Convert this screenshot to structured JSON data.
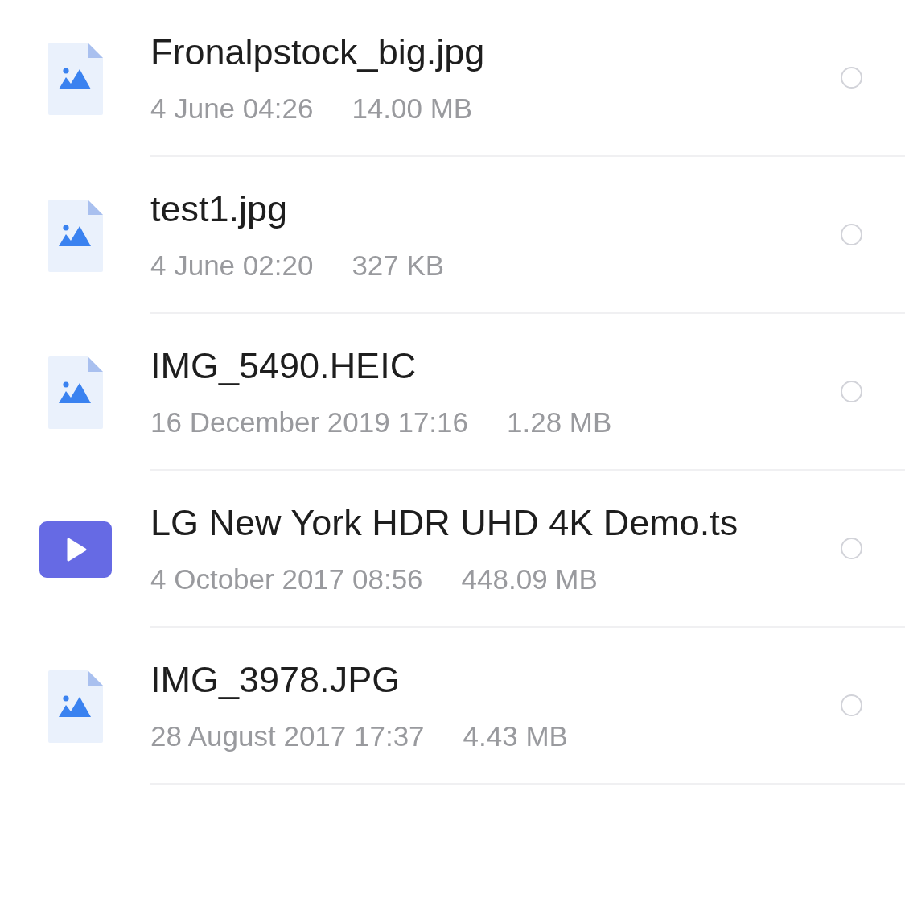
{
  "files": [
    {
      "kind": "image",
      "name": "Fronalpstock_big.jpg",
      "date": "4 June 04:26",
      "size": "14.00 MB",
      "selected": false
    },
    {
      "kind": "image",
      "name": "test1.jpg",
      "date": "4 June 02:20",
      "size": "327 KB",
      "selected": false
    },
    {
      "kind": "image",
      "name": "IMG_5490.HEIC",
      "date": "16 December 2019 17:16",
      "size": "1.28 MB",
      "selected": false
    },
    {
      "kind": "video",
      "name": "LG New York HDR UHD 4K Demo.ts",
      "date": "4 October 2017 08:56",
      "size": "448.09 MB",
      "selected": false
    },
    {
      "kind": "image",
      "name": "IMG_3978.JPG",
      "date": "28 August 2017 17:37",
      "size": "4.43 MB",
      "selected": false
    }
  ]
}
